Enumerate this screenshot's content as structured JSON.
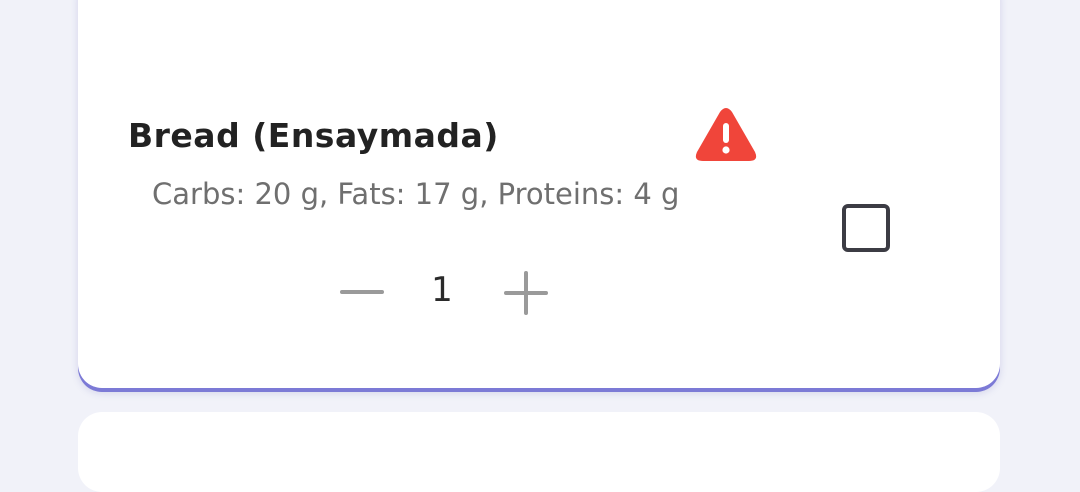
{
  "food_item": {
    "name": "Bread (Ensaymada)",
    "macros": "Carbs: 20 g, Fats: 17 g, Proteins: 4 g",
    "quantity": "1",
    "selected": false,
    "warning_icon": "warning-triangle-icon",
    "warning_color": "#f0453a"
  },
  "colors": {
    "background": "#f1f2f9",
    "card": "#ffffff",
    "card_accent_shadow": "#7c7ad6",
    "title_text": "#222222",
    "secondary_text": "#6f6f6f",
    "stepper_icon": "#9a9a9a",
    "checkbox_border": "#3c3c44"
  }
}
